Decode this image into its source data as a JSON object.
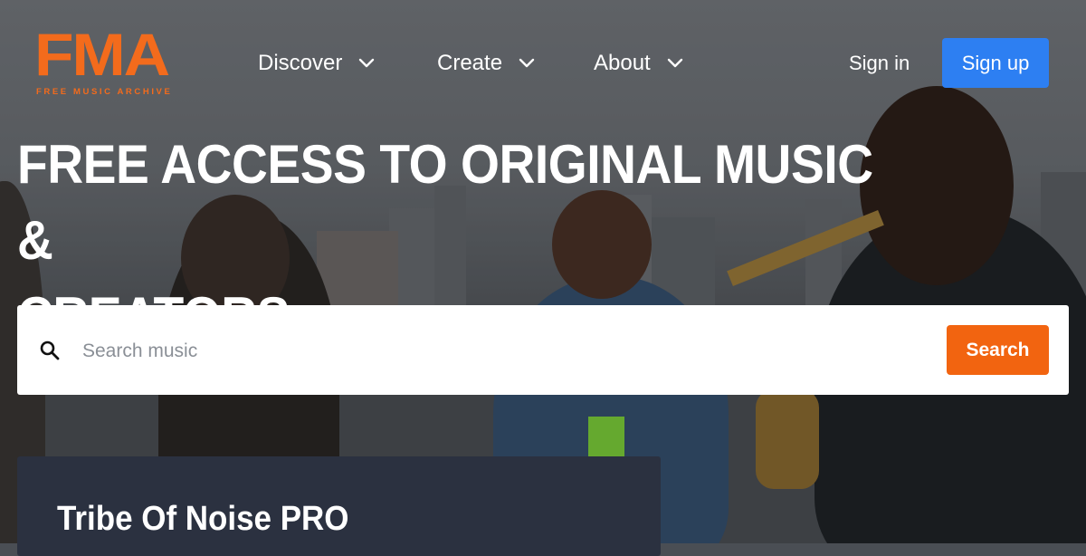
{
  "brand": {
    "logo_text": "FMA",
    "logo_tagline": "FREE MUSIC ARCHIVE",
    "accent_color": "#f36b1c"
  },
  "nav": {
    "items": [
      {
        "label": "Discover",
        "icon": "chevron-down-icon"
      },
      {
        "label": "Create",
        "icon": "chevron-down-icon"
      },
      {
        "label": "About",
        "icon": "chevron-down-icon"
      }
    ],
    "signin_label": "Sign in",
    "signup_label": "Sign up",
    "signup_color": "#2d7ff2"
  },
  "hero": {
    "title_line1": "FREE ACCESS TO ORIGINAL MUSIC &",
    "title_line2": "CREATORS"
  },
  "search": {
    "icon": "search-icon",
    "placeholder": "Search music",
    "value": "",
    "button_label": "Search",
    "button_color": "#f26410"
  },
  "featured_card": {
    "title": "Tribe Of Noise PRO",
    "background_color": "#2b3140"
  }
}
